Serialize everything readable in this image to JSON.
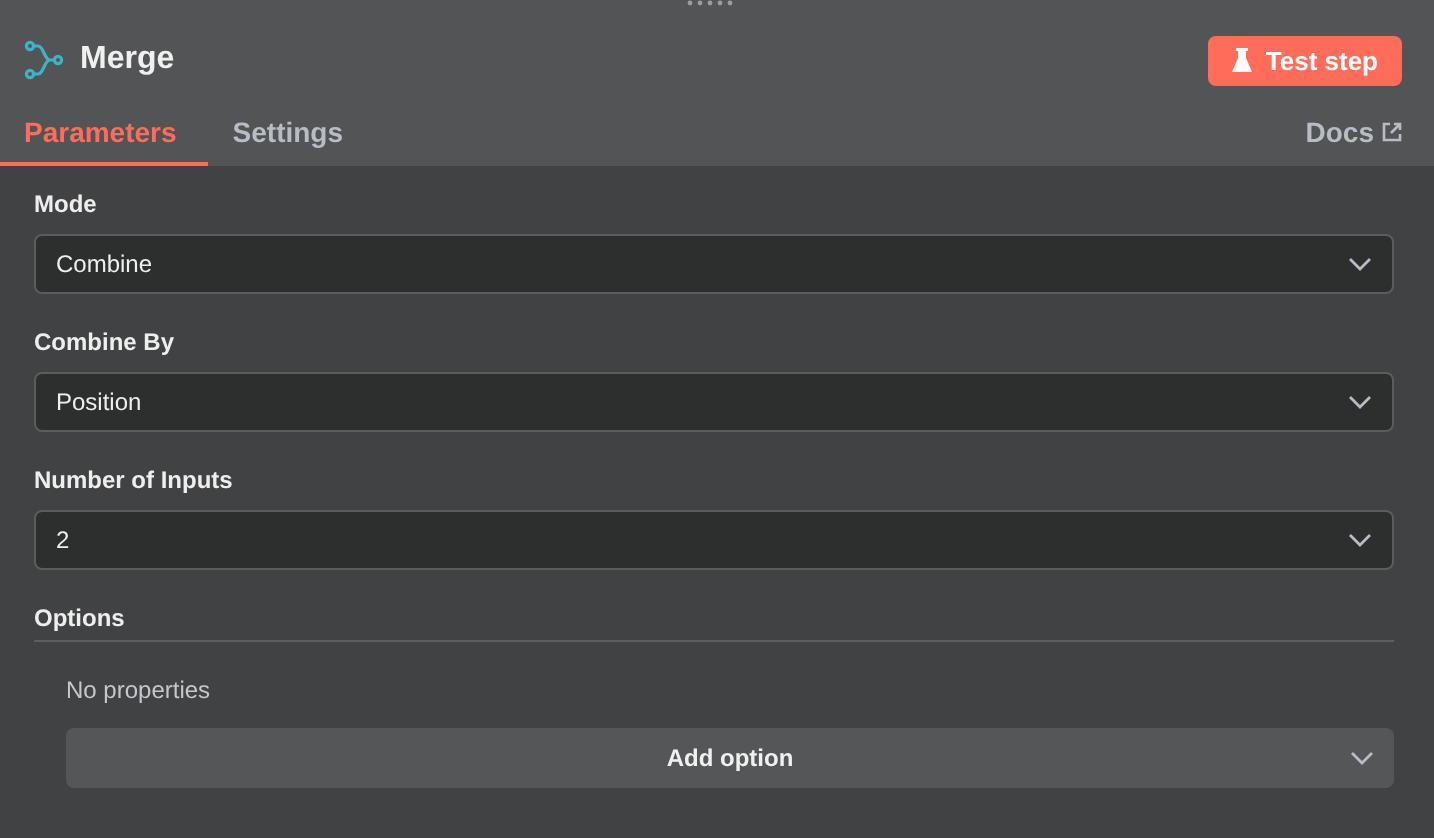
{
  "node": {
    "title": "Merge"
  },
  "test_button": {
    "label": "Test step"
  },
  "tabs": [
    {
      "label": "Parameters",
      "selected": true
    },
    {
      "label": "Settings",
      "selected": false
    }
  ],
  "docs_link": {
    "label": "Docs"
  },
  "parameters": [
    {
      "label": "Mode",
      "value": "Combine"
    },
    {
      "label": "Combine By",
      "value": "Position"
    },
    {
      "label": "Number of Inputs",
      "value": "2"
    }
  ],
  "options": {
    "title": "Options",
    "empty_text": "No properties",
    "add_button": "Add option"
  }
}
